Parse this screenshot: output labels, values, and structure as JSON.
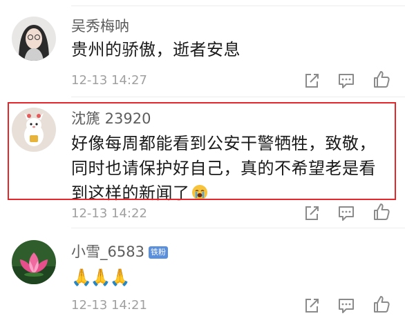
{
  "comments": [
    {
      "username": "吴秀梅呐",
      "text": "贵州的骄傲，逝者安息",
      "timestamp": "12-13 14:27",
      "icons": [
        "share-icon",
        "comment-icon",
        "like-icon"
      ]
    },
    {
      "username": "沈篪 23920",
      "text": "好像每周都能看到公安干警牺牲，致敬，同时也请保护好自己，真的不希望老是看到这样的新闻了",
      "text_emoji": "crying-face-emoji",
      "timestamp": "12-13 14:22",
      "highlighted": true,
      "highlight_color": "#e3262a",
      "icons": [
        "share-icon",
        "comment-icon",
        "like-icon"
      ]
    },
    {
      "username": "小雪_6583",
      "badge": "铁粉",
      "badge_color": "#5a8fdc",
      "text": "🙏🙏🙏",
      "timestamp": "12-13 14:21",
      "icons": [
        "share-icon",
        "comment-icon",
        "like-icon"
      ]
    }
  ]
}
